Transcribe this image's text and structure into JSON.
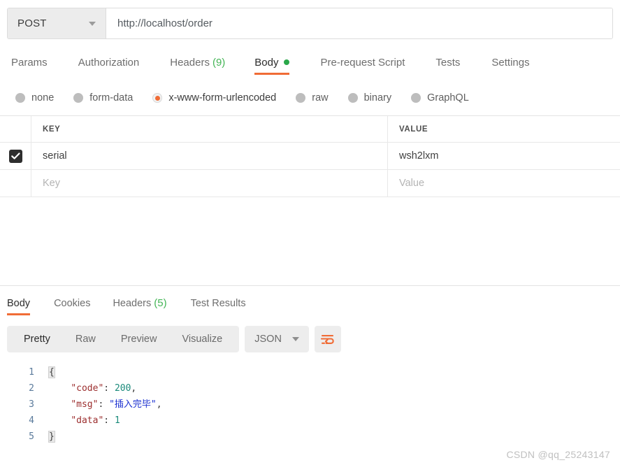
{
  "request": {
    "method": "POST",
    "url": "http://localhost/order",
    "tabs": [
      {
        "label": "Params",
        "count": null,
        "active": false,
        "dot": false
      },
      {
        "label": "Authorization",
        "count": null,
        "active": false,
        "dot": false
      },
      {
        "label": "Headers",
        "count": "(9)",
        "active": false,
        "dot": false
      },
      {
        "label": "Body",
        "count": null,
        "active": true,
        "dot": true
      },
      {
        "label": "Pre-request Script",
        "count": null,
        "active": false,
        "dot": false
      },
      {
        "label": "Tests",
        "count": null,
        "active": false,
        "dot": false
      },
      {
        "label": "Settings",
        "count": null,
        "active": false,
        "dot": false
      }
    ],
    "body_modes": [
      {
        "label": "none",
        "selected": false
      },
      {
        "label": "form-data",
        "selected": false
      },
      {
        "label": "x-www-form-urlencoded",
        "selected": true
      },
      {
        "label": "raw",
        "selected": false
      },
      {
        "label": "binary",
        "selected": false
      },
      {
        "label": "GraphQL",
        "selected": false
      }
    ],
    "table": {
      "headers": {
        "key": "KEY",
        "value": "VALUE"
      },
      "rows": [
        {
          "checked": true,
          "key": "serial",
          "value": "wsh2lxm",
          "placeholder": false
        },
        {
          "checked": false,
          "key": "Key",
          "value": "Value",
          "placeholder": true
        }
      ]
    }
  },
  "response": {
    "tabs": [
      {
        "label": "Body",
        "count": null,
        "active": true
      },
      {
        "label": "Cookies",
        "count": null,
        "active": false
      },
      {
        "label": "Headers",
        "count": "(5)",
        "active": false
      },
      {
        "label": "Test Results",
        "count": null,
        "active": false
      }
    ],
    "view_modes": [
      {
        "label": "Pretty",
        "active": true
      },
      {
        "label": "Raw",
        "active": false
      },
      {
        "label": "Preview",
        "active": false
      },
      {
        "label": "Visualize",
        "active": false
      }
    ],
    "format": "JSON",
    "wrap_icon": "word-wrap-icon",
    "code": {
      "line_numbers": [
        "1",
        "2",
        "3",
        "4",
        "5"
      ],
      "lines": [
        {
          "indent": 0,
          "segments": [
            {
              "t": "{",
              "c": "pun",
              "hl": true
            }
          ]
        },
        {
          "indent": 4,
          "segments": [
            {
              "t": "\"code\"",
              "c": "key"
            },
            {
              "t": ": ",
              "c": "pun"
            },
            {
              "t": "200",
              "c": "num"
            },
            {
              "t": ",",
              "c": "pun"
            }
          ]
        },
        {
          "indent": 4,
          "segments": [
            {
              "t": "\"msg\"",
              "c": "key"
            },
            {
              "t": ": ",
              "c": "pun"
            },
            {
              "t": "\"插入完毕\"",
              "c": "str"
            },
            {
              "t": ",",
              "c": "pun"
            }
          ]
        },
        {
          "indent": 4,
          "segments": [
            {
              "t": "\"data\"",
              "c": "key"
            },
            {
              "t": ": ",
              "c": "pun"
            },
            {
              "t": "1",
              "c": "num"
            }
          ]
        },
        {
          "indent": 0,
          "segments": [
            {
              "t": "}",
              "c": "pun",
              "hl": true
            }
          ]
        }
      ]
    }
  },
  "watermark": "CSDN @qq_25243147",
  "colors": {
    "accent": "#f06c36",
    "success": "#2aa84a",
    "count": "#44b556",
    "checkbox": "#2e2e2e"
  }
}
